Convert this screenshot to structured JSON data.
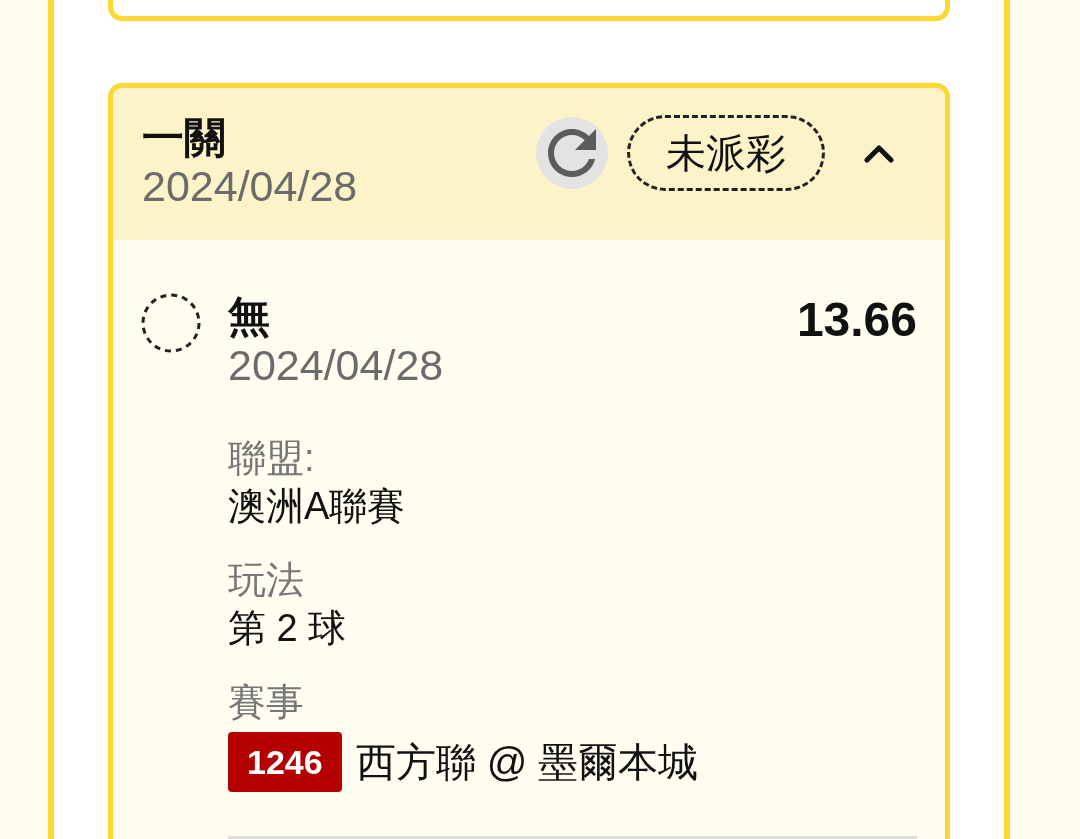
{
  "bet": {
    "title": "一關",
    "date": "2024/04/28",
    "status": "未派彩",
    "expanded": true
  },
  "selections": [
    {
      "name": "無",
      "date": "2024/04/28",
      "odds": "13.66",
      "settled": false,
      "details": [
        {
          "label": "聯盟:",
          "value": "澳洲A聯賽"
        },
        {
          "label": "玩法",
          "value": "第 2 球"
        },
        {
          "label": "賽事",
          "match_number": "1246",
          "value": "西方聯 @ 墨爾本城"
        }
      ]
    }
  ]
}
